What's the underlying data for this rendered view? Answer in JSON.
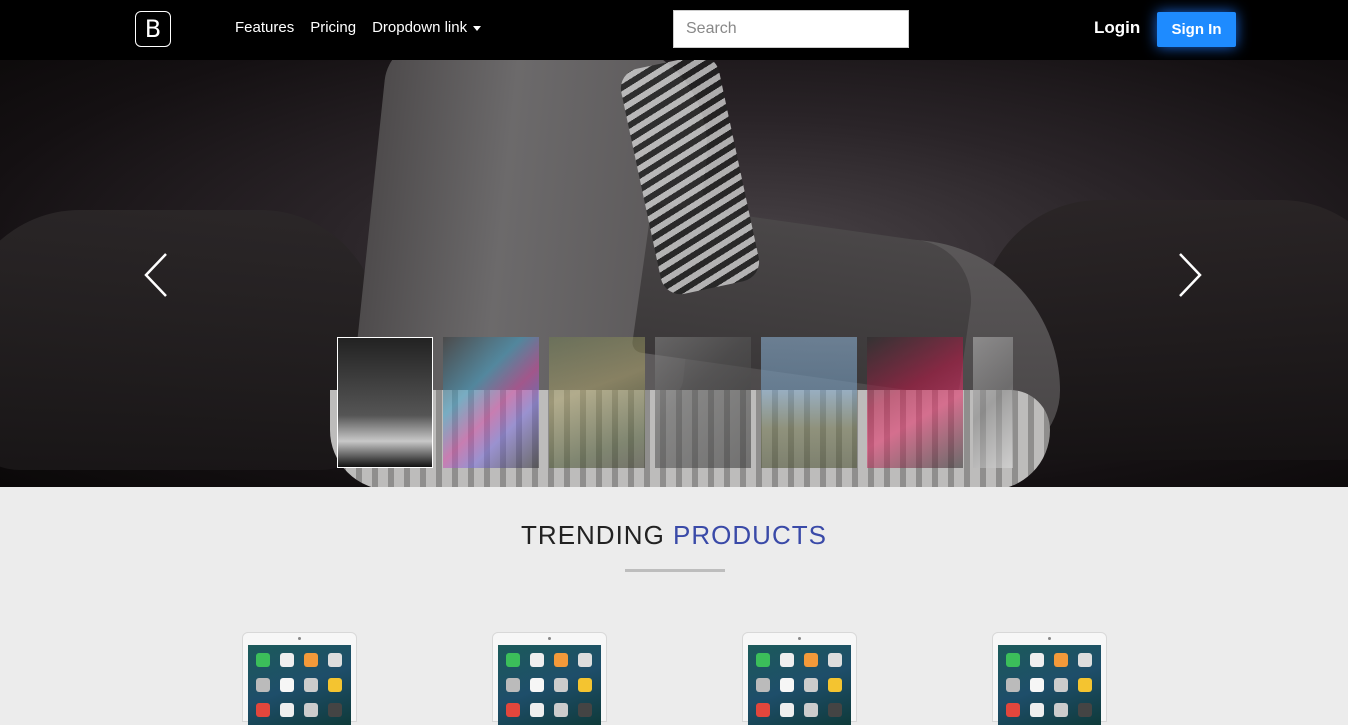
{
  "navbar": {
    "brand": "B",
    "links": [
      "Features",
      "Pricing",
      "Dropdown link"
    ],
    "search_placeholder": "Search",
    "login": "Login",
    "signin": "Sign In"
  },
  "hero": {
    "thumbnail_count": 7,
    "active_thumbnail": 1
  },
  "trending": {
    "title_main": "TRENDING",
    "title_accent": "PRODUCTS",
    "product_count": 4
  },
  "colors": {
    "accent": "#3a4aa8",
    "signin_bg": "#1e8bff",
    "navbar_bg": "#000000",
    "page_bg": "#ececec"
  }
}
